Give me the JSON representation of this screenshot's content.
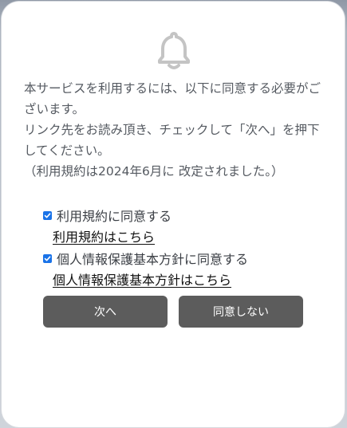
{
  "dialog": {
    "icon": "bell-icon",
    "message_lines": [
      "本サービスを利用するには、以下に同意する必要がございます。",
      "リンク先をお読み頂き、チェックして「次へ」を押下してください。",
      "（利用規約は2024年6月に 改定されました。）"
    ],
    "consents": [
      {
        "label": "利用規約に同意する",
        "checked": true,
        "link_text": "利用規約はこちら"
      },
      {
        "label": "個人情報保護基本方針に同意する",
        "checked": true,
        "link_text": "個人情報保護基本方針はこちら"
      }
    ],
    "buttons": {
      "next": "次へ",
      "decline": "同意しない"
    }
  },
  "colors": {
    "button_bg": "#5c5c5c",
    "checkbox_accent": "#1a73e8",
    "icon_color": "#c4c4c4",
    "text": "#555a61"
  }
}
